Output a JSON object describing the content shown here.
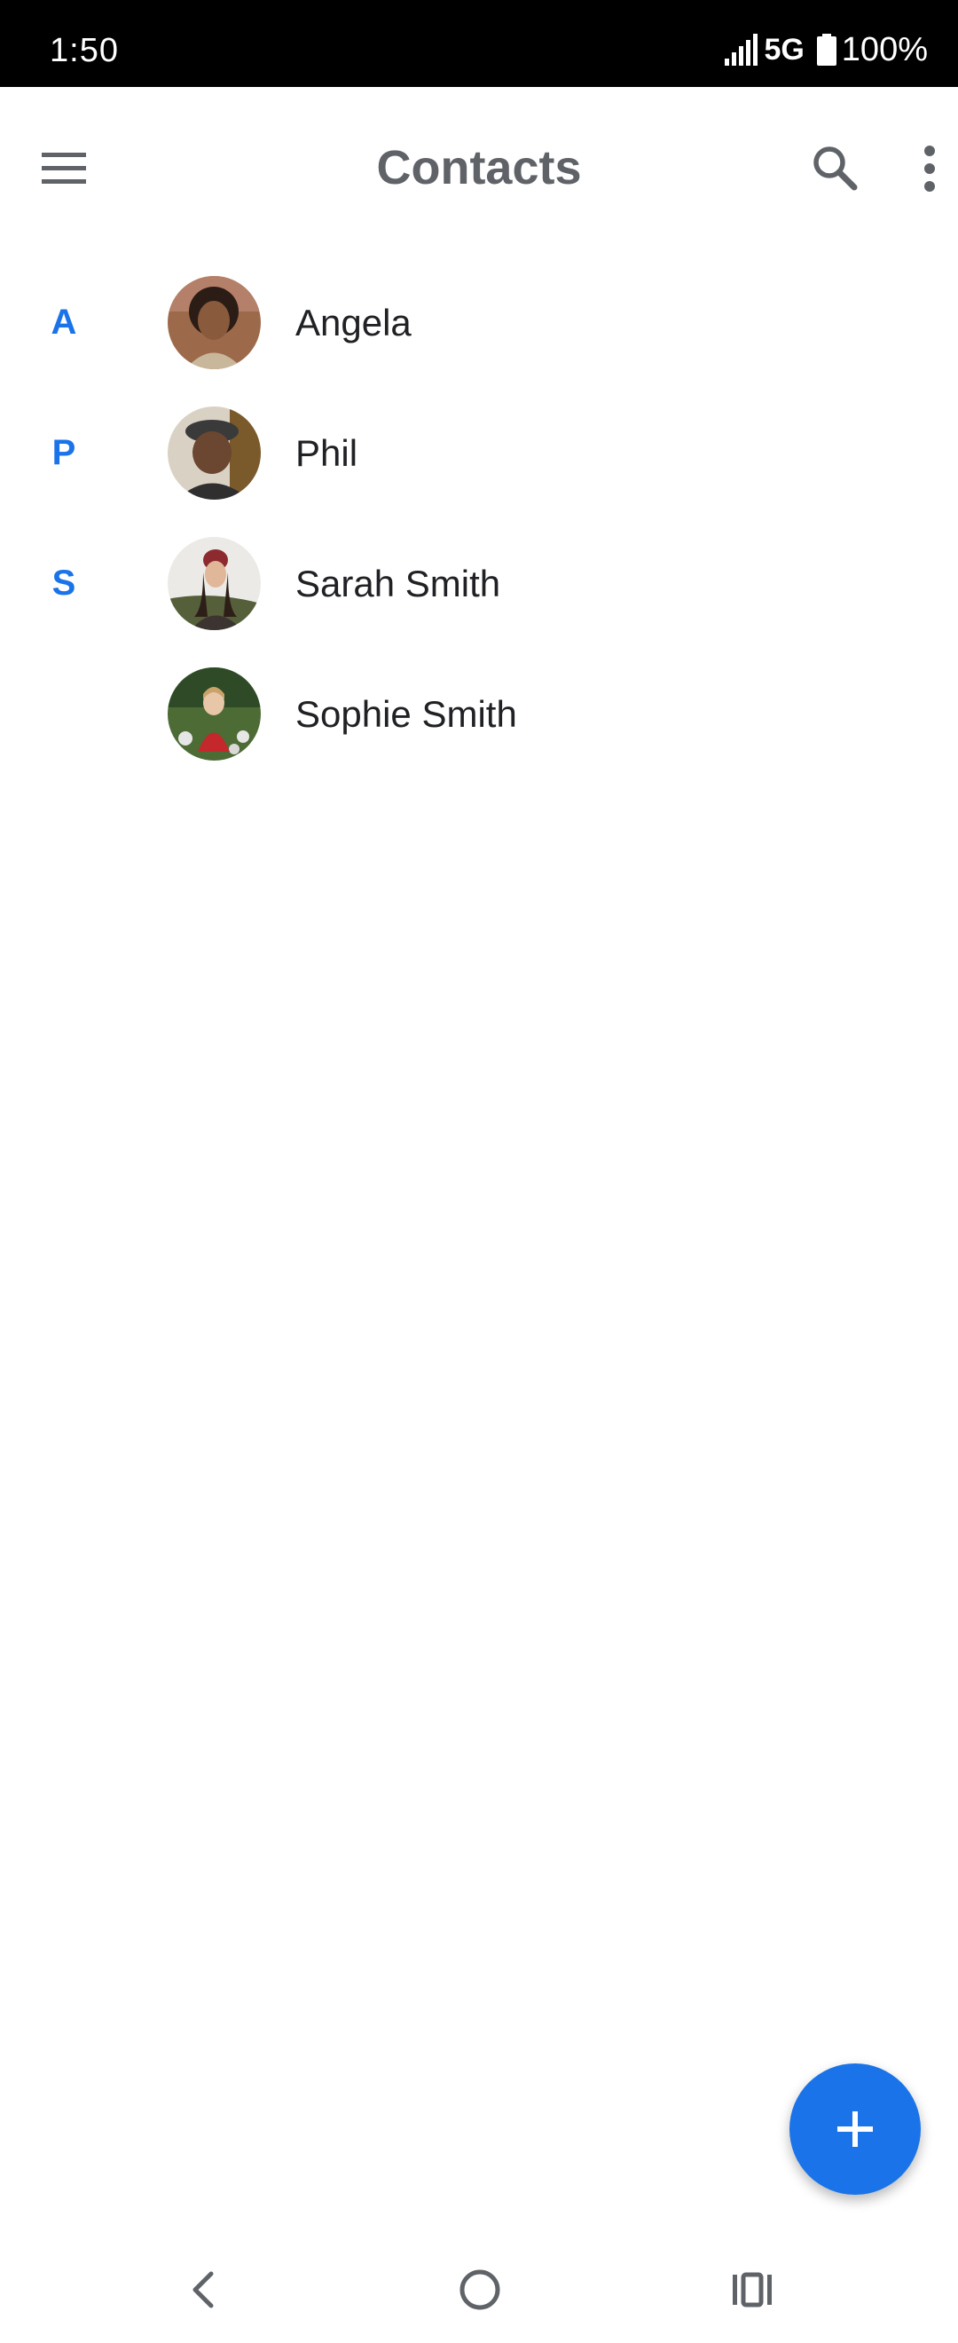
{
  "status_bar": {
    "time": "1:50",
    "network": "5G",
    "battery": "100%",
    "icons": [
      "signal-icon",
      "battery-icon"
    ]
  },
  "app_bar": {
    "title": "Contacts",
    "icons": [
      "menu-icon",
      "search-icon",
      "more-vert-icon"
    ]
  },
  "contacts": [
    {
      "section": "A",
      "name": "Angela"
    },
    {
      "section": "P",
      "name": "Phil"
    },
    {
      "section": "S",
      "name": "Sarah Smith"
    },
    {
      "section": "",
      "name": "Sophie Smith"
    }
  ],
  "fab": {
    "icon": "plus-icon"
  },
  "nav_bar": {
    "icons": [
      "back-icon",
      "home-icon",
      "recents-icon"
    ]
  },
  "colors": {
    "accent": "#1a73e8",
    "title_gray": "#5f6368",
    "text": "#202124",
    "status_bar_bg": "#000000"
  }
}
